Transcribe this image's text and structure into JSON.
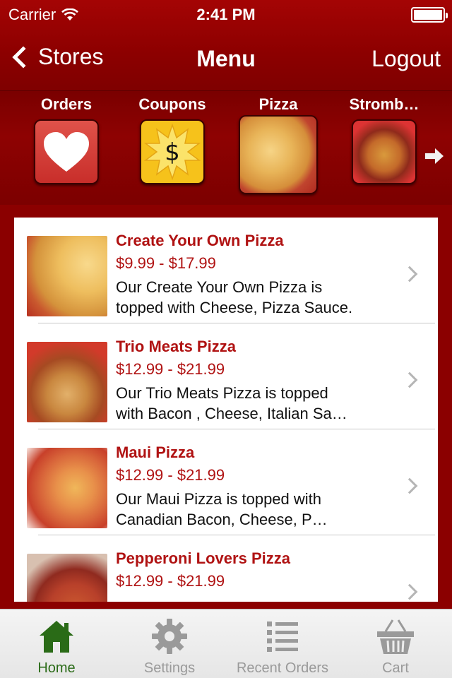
{
  "status_bar": {
    "carrier": "Carrier",
    "time": "2:41 PM"
  },
  "nav": {
    "back_label": "Stores",
    "title": "Menu",
    "logout_label": "Logout"
  },
  "categories": [
    {
      "label": "Orders",
      "icon": "heart-icon"
    },
    {
      "label": "Coupons",
      "icon": "dollar-badge-icon"
    },
    {
      "label": "Pizza",
      "icon": "pizza-image"
    },
    {
      "label": "Stromb…",
      "icon": "stromboli-image"
    }
  ],
  "menu_items": [
    {
      "name": "Create Your Own Pizza",
      "price": "$9.99 - $17.99",
      "desc_line1": "Our Create Your Own Pizza is",
      "desc_line2": "topped with Cheese, Pizza Sauce."
    },
    {
      "name": "Trio Meats Pizza",
      "price": "$12.99 - $21.99",
      "desc_line1": "Our Trio Meats Pizza is topped",
      "desc_line2": "with Bacon , Cheese, Italian Sa…"
    },
    {
      "name": "Maui Pizza",
      "price": "$12.99 - $21.99",
      "desc_line1": "Our Maui Pizza is topped with",
      "desc_line2": "Canadian Bacon, Cheese, P…"
    },
    {
      "name": "Pepperoni Lovers Pizza",
      "price": "$12.99 - $21.99",
      "desc_line1": "",
      "desc_line2": ""
    }
  ],
  "tabs": [
    {
      "label": "Home",
      "icon": "home-icon",
      "active": true
    },
    {
      "label": "Settings",
      "icon": "gear-icon",
      "active": false
    },
    {
      "label": "Recent Orders",
      "icon": "list-icon",
      "active": false
    },
    {
      "label": "Cart",
      "icon": "basket-icon",
      "active": false
    }
  ],
  "colors": {
    "brand_red": "#8b0000",
    "item_title": "#b01212",
    "active_tab": "#2a6b17",
    "inactive_tab": "#9a9a9a"
  }
}
